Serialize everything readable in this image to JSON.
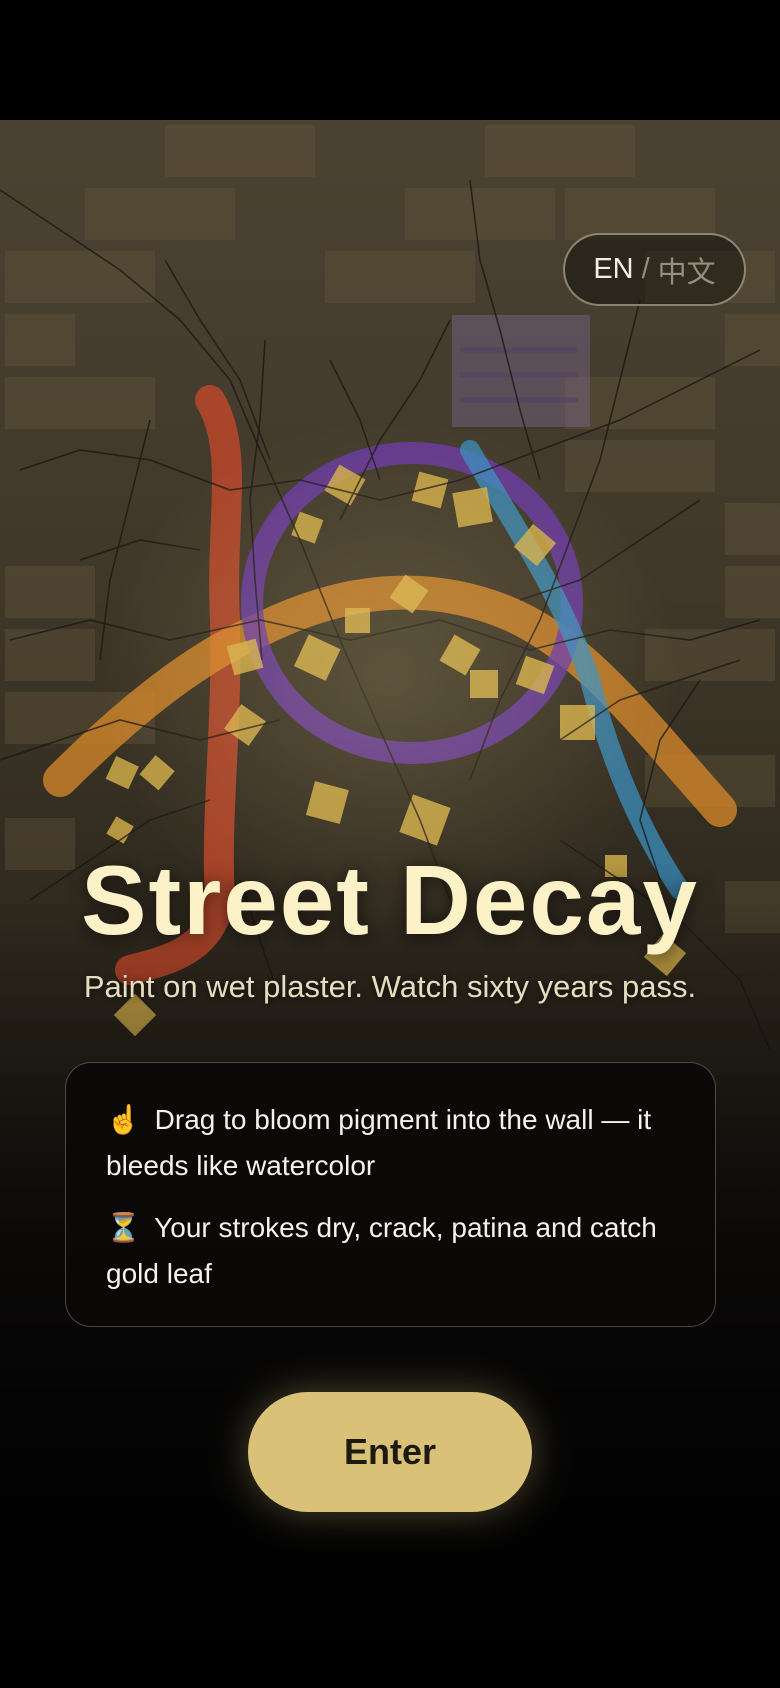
{
  "lang_toggle": {
    "en": "EN",
    "separator": "/",
    "zh": "中文"
  },
  "title": "Street Decay",
  "subtitle": "Paint on wet plaster. Watch sixty years pass.",
  "hints": [
    {
      "icon": "☝",
      "icon_name": "pointing-finger-icon",
      "text": "Drag to bloom pigment into the wall — it bleeds like watercolor"
    },
    {
      "icon": "⏳",
      "icon_name": "hourglass-icon",
      "text": "Your strokes dry, crack, patina and catch gold leaf"
    }
  ],
  "enter_label": "Enter",
  "colors": {
    "accent": "#d9c277",
    "title": "#fdf1c8",
    "pigment_orange": "#d9892a",
    "pigment_red": "#c2472a",
    "pigment_purple": "#6a3aa8",
    "pigment_blue": "#3a8fbf",
    "gold_leaf": "#d8b24a"
  }
}
